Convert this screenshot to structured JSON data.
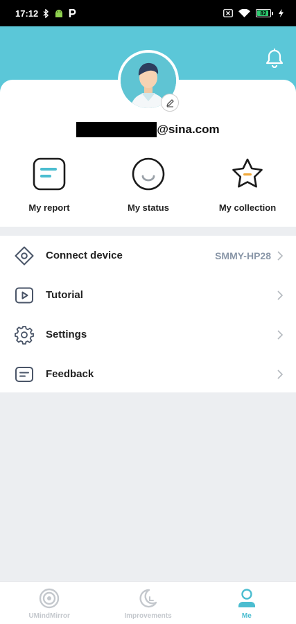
{
  "status_bar": {
    "time": "17:12",
    "battery_level": "82"
  },
  "profile": {
    "email_domain": "@sina.com"
  },
  "quick_actions": [
    {
      "label": "My report",
      "icon": "report-icon"
    },
    {
      "label": "My status",
      "icon": "status-face-icon"
    },
    {
      "label": "My collection",
      "icon": "star-icon"
    }
  ],
  "menu": {
    "connect_device": {
      "label": "Connect device",
      "value": "SMMY-HP28",
      "icon": "device-icon"
    },
    "tutorial": {
      "label": "Tutorial",
      "icon": "play-icon"
    },
    "settings": {
      "label": "Settings",
      "icon": "gear-icon"
    },
    "feedback": {
      "label": "Feedback",
      "icon": "message-icon"
    }
  },
  "tabs": [
    {
      "label": "UMindMirror",
      "icon": "mirror-icon",
      "active": false
    },
    {
      "label": "Improvements",
      "icon": "moon-icon",
      "active": false
    },
    {
      "label": "Me",
      "icon": "person-icon",
      "active": true
    }
  ],
  "colors": {
    "accent": "#5bc7d8",
    "tab_active": "#4bbdd0",
    "tab_inactive": "#c4c8cd",
    "muted_value": "#8a97a8"
  }
}
